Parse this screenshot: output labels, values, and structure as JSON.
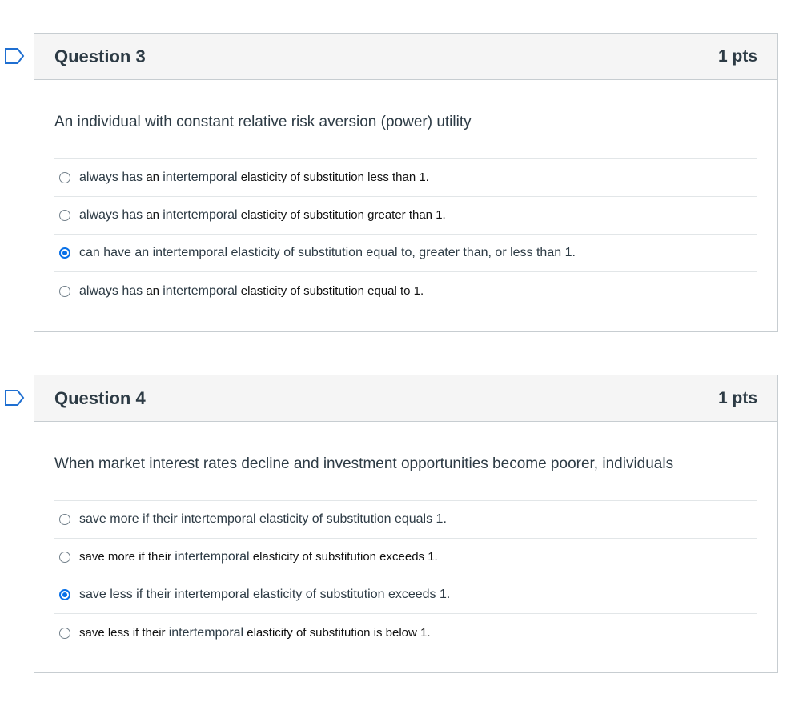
{
  "questions": [
    {
      "title": "Question 3",
      "points": "1 pts",
      "text": "An individual with constant relative risk aversion (power) utility",
      "answers": [
        {
          "parts": [
            "always has",
            " an ",
            "intertemporal",
            " elasticity of substitution less than 1."
          ],
          "selected": false
        },
        {
          "parts": [
            "always has",
            " an ",
            "intertemporal",
            " elasticity of substitution greater than 1."
          ],
          "selected": false
        },
        {
          "parts": [
            "can have an intertemporal elasticity of substitution equal to, greater than, or less than 1."
          ],
          "selected": true
        },
        {
          "parts": [
            "always has",
            " an ",
            "intertemporal",
            " elasticity of substitution equal to 1."
          ],
          "selected": false
        }
      ]
    },
    {
      "title": "Question 4",
      "points": "1 pts",
      "text": "When market interest rates decline and investment opportunities become poorer, individuals",
      "answers": [
        {
          "parts": [
            "save more if their intertemporal elasticity of substitution equals 1."
          ],
          "selected": false
        },
        {
          "parts": [
            "save more if their ",
            "intertemporal",
            " elasticity of substitution exceeds 1."
          ],
          "selected": false
        },
        {
          "parts": [
            "save less if their intertemporal elasticity of substitution exceeds 1."
          ],
          "selected": true
        },
        {
          "parts": [
            "save less if their ",
            "intertemporal",
            " elasticity of substitution is below 1."
          ],
          "selected": false
        }
      ]
    }
  ],
  "colors": {
    "accent": "#0770e8",
    "flag": "#1f6fd1",
    "text": "#2d3b45",
    "header_bg": "#f5f5f5",
    "border": "#c7cdd1"
  },
  "icons": {
    "flag": "flag-outline-icon"
  }
}
